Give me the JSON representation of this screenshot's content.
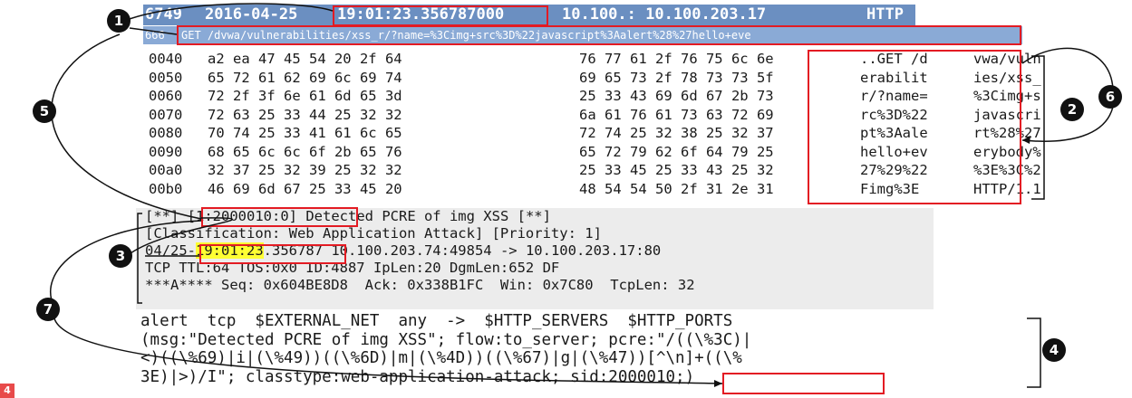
{
  "packet_list": {
    "row1": {
      "number": "6749",
      "date": "2016-04-25",
      "time": "19:01:23.356787000",
      "source": "10.100.: 10.100.203.17",
      "protocol": "HTTP"
    },
    "row2": {
      "number": "666",
      "info": "GET /dvwa/vulnerabilities/xss_r/?name=%3Cimg+src%3D%22javascript%3Aalert%28%27hello+eve"
    }
  },
  "hex_dump": [
    {
      "offset": "0040",
      "hex1": "a2 ea 47 45 54 20 2f 64",
      "hex2": "76 77 61 2f 76 75 6c 6e",
      "ascii1": "..GET /d",
      "ascii2": "vwa/vuln"
    },
    {
      "offset": "0050",
      "hex1": "65 72 61 62 69 6c 69 74",
      "hex2": "69 65 73 2f 78 73 73 5f",
      "ascii1": "erabilit",
      "ascii2": "ies/xss_"
    },
    {
      "offset": "0060",
      "hex1": "72 2f 3f 6e 61 6d 65 3d",
      "hex2": "25 33 43 69 6d 67 2b 73",
      "ascii1": "r/?name=",
      "ascii2": "%3Cimg+s"
    },
    {
      "offset": "0070",
      "hex1": "72 63 25 33 44 25 32 32",
      "hex2": "6a 61 76 61 73 63 72 69",
      "ascii1": "rc%3D%22",
      "ascii2": "javascri"
    },
    {
      "offset": "0080",
      "hex1": "70 74 25 33 41 61 6c 65",
      "hex2": "72 74 25 32 38 25 32 37",
      "ascii1": "pt%3Aale",
      "ascii2": "rt%28%27"
    },
    {
      "offset": "0090",
      "hex1": "68 65 6c 6c 6f 2b 65 76",
      "hex2": "65 72 79 62 6f 64 79 25",
      "ascii1": "hello+ev",
      "ascii2": "erybody%"
    },
    {
      "offset": "00a0",
      "hex1": "32 37 25 32 39 25 32 32",
      "hex2": "25 33 45 25 33 43 25 32",
      "ascii1": "27%29%22",
      "ascii2": "%3E%3C%2"
    },
    {
      "offset": "00b0",
      "hex1": "46 69 6d 67 25 33 45 20",
      "hex2": "48 54 54 50 2f 31 2e 31",
      "ascii1": "Fimg%3E ",
      "ascii2": "HTTP/1.1"
    }
  ],
  "alert": {
    "line1_pre": "[**] ",
    "sid_ref": "[1:2000010:0]",
    "line1_post": " Detected PCRE of img XSS [**]",
    "line2": "[Classification: Web Application Attack] [Priority: 1]",
    "line3_date": "04/25-",
    "line3_time": "19:01:23",
    "line3_frac": ".356787",
    "line3_rest": " 10.100.203.74:49854 -> 10.100.203.17:80",
    "line4": "TCP TTL:64 TOS:0x0 ID:4887 IpLen:20 DgmLen:652 DF",
    "line5": "***A**** Seq: 0x604BE8D8  Ack: 0x338B1FC  Win: 0x7C80  TcpLen: 32"
  },
  "rule": {
    "line1": "alert  tcp  $EXTERNAL_NET  any  ->  $HTTP_SERVERS  $HTTP_PORTS",
    "line2": "(msg:\"Detected PCRE of img XSS\"; flow:to_server; pcre:\"/((\\%3C)|",
    "line3": "<)((\\%69)|i|(\\%49))((\\%6D)|m|(\\%4D))((\\%67)|g|(\\%47))[^\\n]+((\\%",
    "line4_pre": "3E)|>)/I\"; classtype:web-application-attack;",
    "line4_sid": "sid:2000010;",
    "line4_post": ")"
  },
  "badges": [
    "1",
    "2",
    "3",
    "4",
    "5",
    "6",
    "7"
  ],
  "corner_badge": "4",
  "colors": {
    "packet_row1": "#6b8fc1",
    "packet_row2": "#8aaad6",
    "highlight_box": "#e31b23",
    "time_highlight": "#ffff33",
    "badge": "#111111"
  }
}
